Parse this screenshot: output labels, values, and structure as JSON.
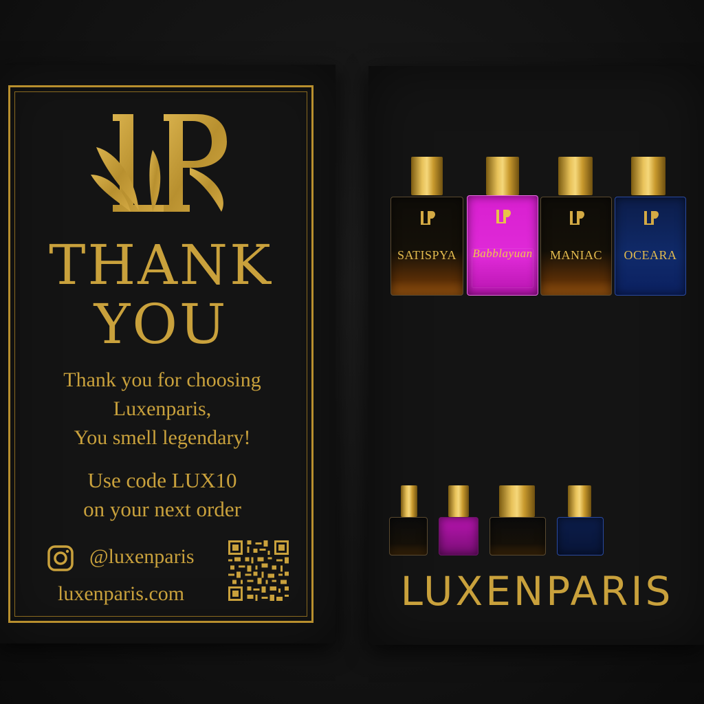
{
  "card_front": {
    "logo": "LP",
    "title_line1": "THANK",
    "title_line2": "YOU",
    "message_line1": "Thank you for choosing",
    "message_line2": "Luxenparis,",
    "message_line3": "You smell legendary!",
    "code_line1": "Use code LUX10",
    "code_line2": "on your next order",
    "instagram_handle": "@luxenparis",
    "website": "luxenparis.com",
    "icons": [
      "instagram-icon",
      "qr-code"
    ]
  },
  "card_back": {
    "bottles": [
      {
        "name": "SATISPYA",
        "color": "#1a1208"
      },
      {
        "name": "Babblayuan",
        "color": "#d81fd0"
      },
      {
        "name": "MANIAC",
        "color": "#1a1208"
      },
      {
        "name": "OCEARA",
        "color": "#102a6a"
      }
    ],
    "small_bottles": [
      {
        "color": "#151008"
      },
      {
        "color": "#b815b0"
      },
      {
        "color": "#151008"
      },
      {
        "color": "#0c1d4a"
      }
    ],
    "brand": "LUXENPARIS"
  },
  "colors": {
    "gold": "#c9a13c",
    "card_background": "#141414"
  }
}
